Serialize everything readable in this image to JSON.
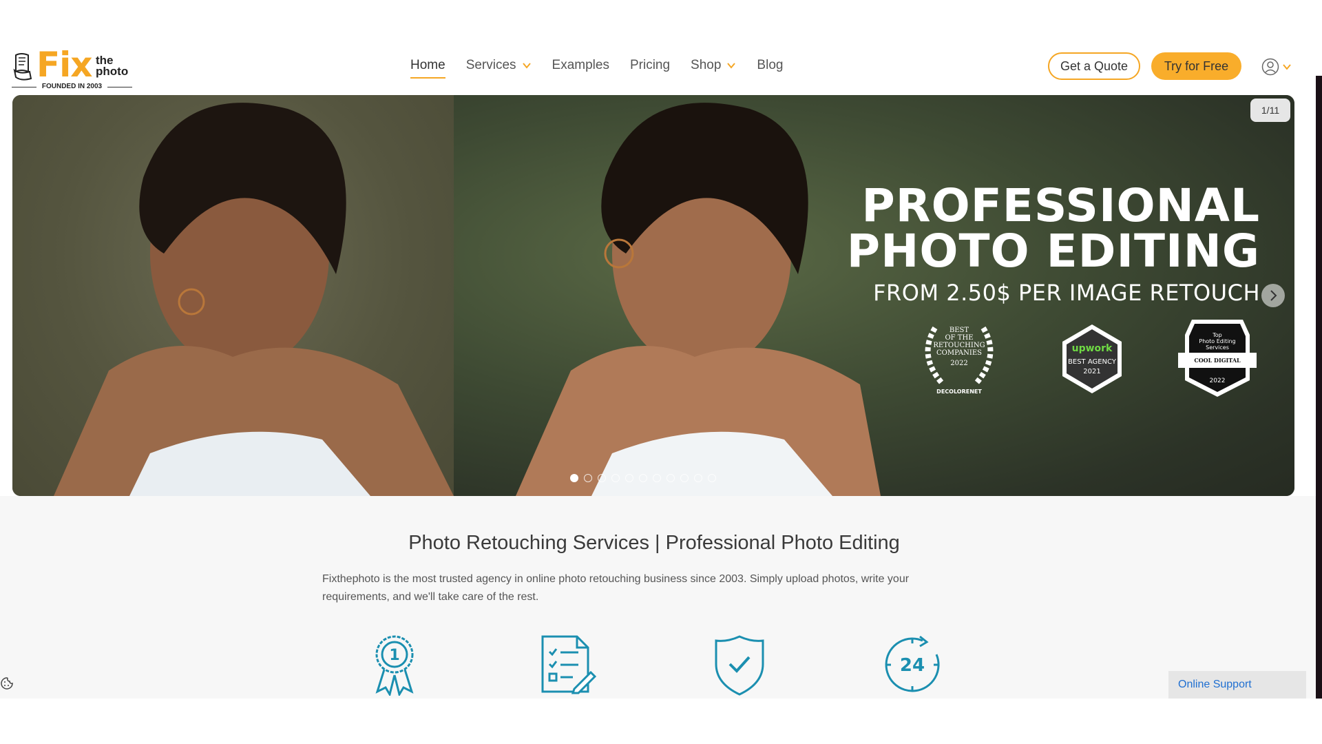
{
  "logo": {
    "brand_fix": "Fix",
    "brand_the": "the",
    "brand_photo": "photo",
    "tagline": "FOUNDED IN 2003",
    "accent": "#f5a623"
  },
  "nav": {
    "items": [
      {
        "label": "Home",
        "active": true,
        "dropdown": false
      },
      {
        "label": "Services",
        "active": false,
        "dropdown": true
      },
      {
        "label": "Examples",
        "active": false,
        "dropdown": false
      },
      {
        "label": "Pricing",
        "active": false,
        "dropdown": false
      },
      {
        "label": "Shop",
        "active": false,
        "dropdown": true
      },
      {
        "label": "Blog",
        "active": false,
        "dropdown": false
      }
    ]
  },
  "header_buttons": {
    "quote": "Get a Quote",
    "try": "Try for Free"
  },
  "hero": {
    "counter": "1/11",
    "headline_line1": "PROFESSIONAL",
    "headline_line2": "PHOTO EDITING",
    "subline": "FROM 2.50$ PER IMAGE RETOUCH",
    "badges": {
      "b1_line1": "BEST",
      "b1_line2": "OF THE",
      "b1_line3": "RETOUCHING",
      "b1_line4": "COMPANIES",
      "b1_year": "2022",
      "b1_source": "DECOLORENET",
      "b2_brand": "upwork",
      "b2_line1": "BEST AGENCY",
      "b2_year": "2021",
      "b3_line1": "Top",
      "b3_line2": "Photo Editing",
      "b3_line3": "Services",
      "b3_brand": "COOL DIGITAL",
      "b3_year": "2022"
    },
    "slides_total": 11,
    "active_slide": 1
  },
  "content": {
    "title": "Photo Retouching Services | Professional Photo Editing",
    "description": "Fixthephoto is the most trusted agency in online photo retouching business since 2003. Simply upload photos, write your requirements, and we'll take care of the rest.",
    "feature_icons": [
      "award-medal-icon",
      "checklist-document-icon",
      "shield-check-icon",
      "clock-24-icon"
    ],
    "icon_color": "#1b8fb0",
    "feature_number_1": "1",
    "feature_number_24": "24"
  },
  "support": {
    "label": "Online Support"
  }
}
